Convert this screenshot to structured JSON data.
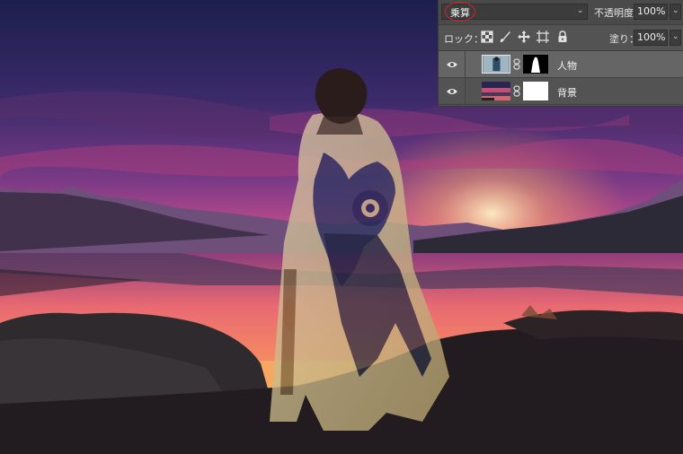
{
  "layers_panel": {
    "blend_mode": "乗算",
    "opacity_label": "不透明度：",
    "opacity_value": "100%",
    "lock_label": "ロック：",
    "fill_label": "塗り：",
    "fill_value": "100%",
    "layers": [
      {
        "name": "人物",
        "visible": true,
        "selected": true
      },
      {
        "name": "背景",
        "visible": true,
        "selected": false
      }
    ]
  },
  "colors": {
    "panel_bg": "#535353",
    "selected_layer_bg": "#656565",
    "highlight_circle": "#d6232a"
  }
}
